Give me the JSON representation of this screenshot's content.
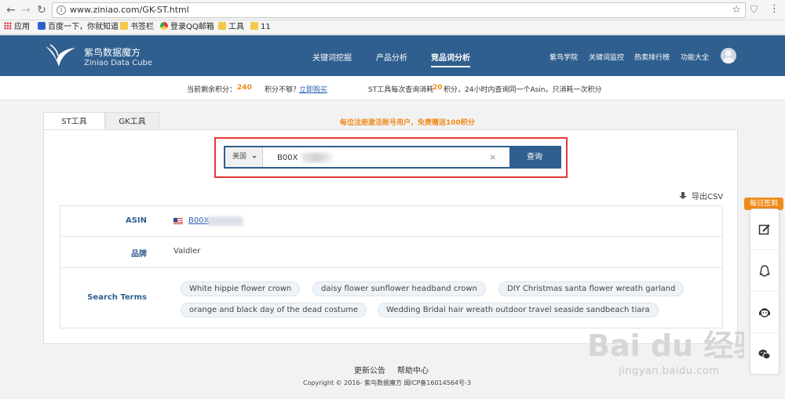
{
  "browser": {
    "url": "www.ziniao.com/GK-ST.html",
    "bookmarks": [
      "应用",
      "百度一下，你就知道",
      "书签栏",
      "登录QQ邮箱",
      "工具",
      "11"
    ]
  },
  "header": {
    "logo_cn": "紫鸟数据魔方",
    "logo_en": "Ziniao Data Cube",
    "nav_main": [
      "关键词挖掘",
      "产品分析",
      "竞品词分析"
    ],
    "nav_sub": [
      "紫鸟学院",
      "关键词监控",
      "热卖排行榜",
      "功能大全"
    ]
  },
  "credits": {
    "remaining_label": "当前剩余积分：",
    "remaining_value": "240",
    "not_enough": "积分不够？",
    "buy_link": "立即购买",
    "rule_1": "ST工具每次查询消耗",
    "rule_cost": "20",
    "rule_2": "积分，24小时内查询同一个Asin，只消耗一次积分"
  },
  "tabs": [
    "ST工具",
    "GK工具"
  ],
  "promo": "每位注册激活账号用户，免费赠送100积分",
  "search": {
    "country": "美国",
    "value": "B00X",
    "button": "查询"
  },
  "export_label": "导出CSV",
  "result": {
    "asin_label": "ASIN",
    "asin_value": "B00X",
    "brand_label": "品牌",
    "brand_value": "Valdler",
    "terms_label": "Search Terms",
    "terms": [
      "White hippie flower crown",
      "daisy flower sunflower headband crown",
      "DIY Christmas santa flower wreath garland",
      "orange and black day of the dead costume",
      "Wedding Bridal hair wreath outdoor travel seaside sandbeach tiara"
    ]
  },
  "footer": {
    "links": [
      "更新公告",
      "帮助中心"
    ],
    "copyright": "Copyright © 2016- 紫鸟数据魔方 闽ICP备16014564号-3"
  },
  "side_toolbar": {
    "checkin": "每日签到",
    "icons": [
      "edit-icon",
      "qq-icon",
      "support-icon",
      "wechat-icon"
    ]
  },
  "watermark": {
    "baidu": "Bai du 经验",
    "url": "jingyan.baidu.com"
  }
}
